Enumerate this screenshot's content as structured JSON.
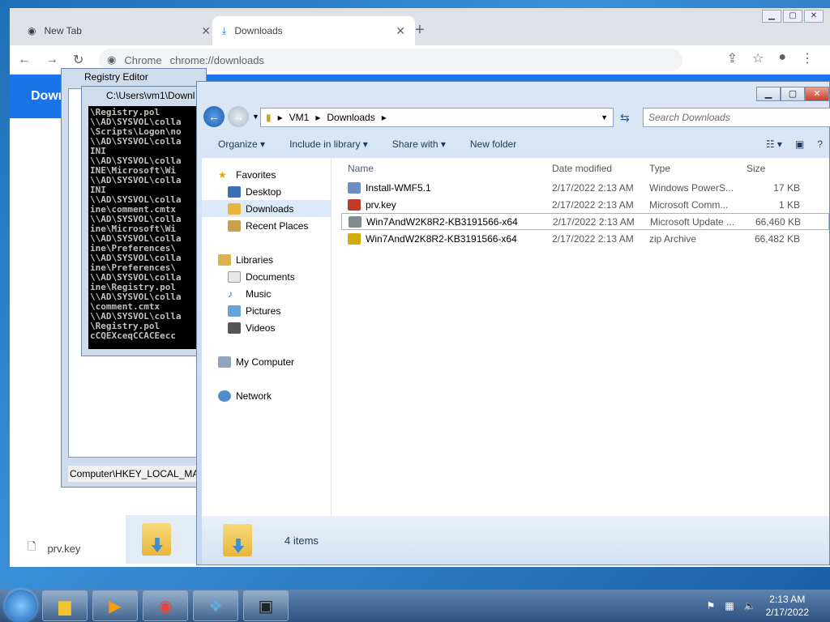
{
  "chrome": {
    "tabs": [
      {
        "label": "New Tab",
        "active": false
      },
      {
        "label": "Downloads",
        "active": true
      }
    ],
    "omnibox_site": "Chrome",
    "omnibox_url": "chrome://downloads",
    "banner_title": "Down",
    "shelf_file": "prv.key"
  },
  "regedit": {
    "title": "Registry Editor",
    "status": "Computer\\HKEY_LOCAL_MAC"
  },
  "cmd": {
    "title": "C:\\Users\\vm1\\Downl",
    "lines": [
      "\\Registry.pol",
      "\\\\AD\\SYSVOL\\colla",
      "\\Scripts\\Logon\\no",
      "\\\\AD\\SYSVOL\\colla",
      "INI",
      "\\\\AD\\SYSVOL\\colla",
      "INE\\Microsoft\\Wi",
      "\\\\AD\\SYSVOL\\colla",
      "INI",
      "\\\\AD\\SYSVOL\\colla",
      "ine\\comment.cmtx",
      "\\\\AD\\SYSVOL\\colla",
      "ine\\Microsoft\\Wi",
      "\\\\AD\\SYSVOL\\colla",
      "ine\\Preferences\\",
      "\\\\AD\\SYSVOL\\colla",
      "ine\\Preferences\\",
      "\\\\AD\\SYSVOL\\colla",
      "ine\\Registry.pol",
      "\\\\AD\\SYSVOL\\colla",
      "\\comment.cmtx",
      "\\\\AD\\SYSVOL\\colla",
      "\\Registry.pol",
      "cCQEXceqCCACEecc"
    ]
  },
  "explorer": {
    "breadcrumb": [
      "VM1",
      "Downloads"
    ],
    "search_placeholder": "Search Downloads",
    "toolbar": {
      "organize": "Organize",
      "include": "Include in library",
      "share": "Share with",
      "new_folder": "New folder"
    },
    "nav": {
      "favorites": "Favorites",
      "desktop": "Desktop",
      "downloads": "Downloads",
      "recent": "Recent Places",
      "libraries": "Libraries",
      "documents": "Documents",
      "music": "Music",
      "pictures": "Pictures",
      "videos": "Videos",
      "computer": "My Computer",
      "network": "Network"
    },
    "columns": {
      "name": "Name",
      "date": "Date modified",
      "type": "Type",
      "size": "Size"
    },
    "files": [
      {
        "name": "Install-WMF5.1",
        "date": "2/17/2022 2:13 AM",
        "type": "Windows PowerS...",
        "size": "17 KB",
        "icon_color": "#6b8fc4"
      },
      {
        "name": "prv.key",
        "date": "2/17/2022 2:13 AM",
        "type": "Microsoft Comm...",
        "size": "1 KB",
        "icon_color": "#c0392b"
      },
      {
        "name": "Win7AndW2K8R2-KB3191566-x64",
        "date": "2/17/2022 2:13 AM",
        "type": "Microsoft Update ...",
        "size": "66,460 KB",
        "icon_color": "#7f8c8d"
      },
      {
        "name": "Win7AndW2K8R2-KB3191566-x64",
        "date": "2/17/2022 2:13 AM",
        "type": "zip Archive",
        "size": "66,482 KB",
        "icon_color": "#d4ac0d"
      }
    ],
    "item_count": "4 items"
  },
  "taskbar": {
    "time": "2:13 AM",
    "date": "2/17/2022"
  }
}
